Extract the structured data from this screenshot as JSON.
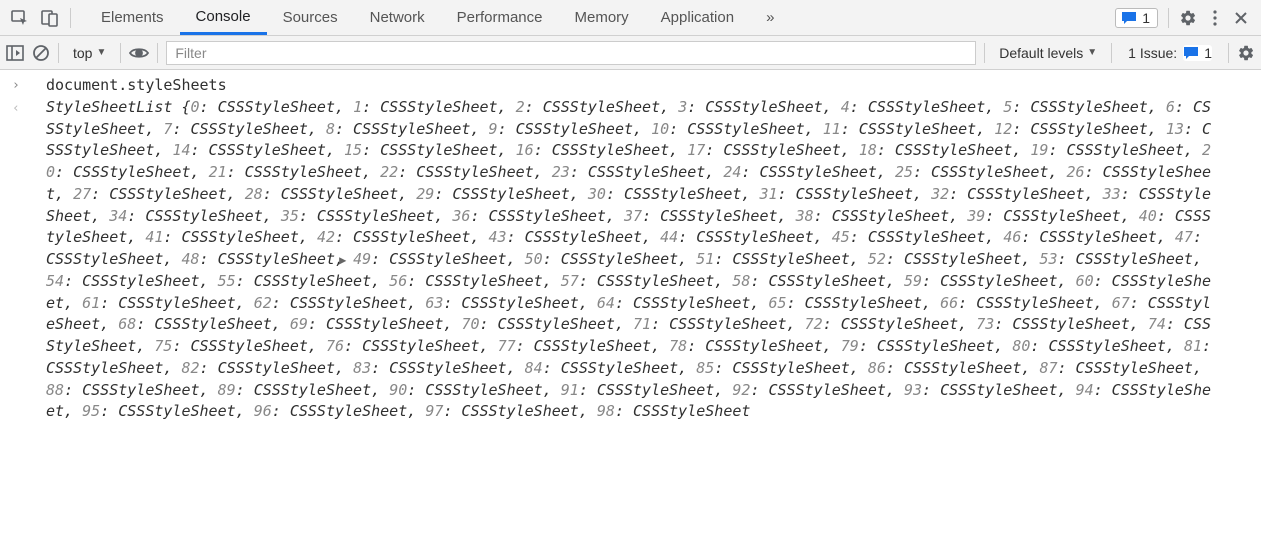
{
  "tabs": [
    "Elements",
    "Console",
    "Sources",
    "Network",
    "Performance",
    "Memory",
    "Application"
  ],
  "active_tab": "Console",
  "more_tabs_glyph": "»",
  "messages_count": "1",
  "toolbar": {
    "context": "top",
    "filter_placeholder": "Filter",
    "levels": "Default levels",
    "issues_label": "1 Issue:",
    "issues_count": "1"
  },
  "prompt_glyph": "›",
  "return_glyph": "‹",
  "command": "document.styleSheets",
  "result": {
    "class_name": "StyleSheetList",
    "item_type": "CSSStyleSheet",
    "count": 99,
    "trailing": "CSSSt"
  }
}
